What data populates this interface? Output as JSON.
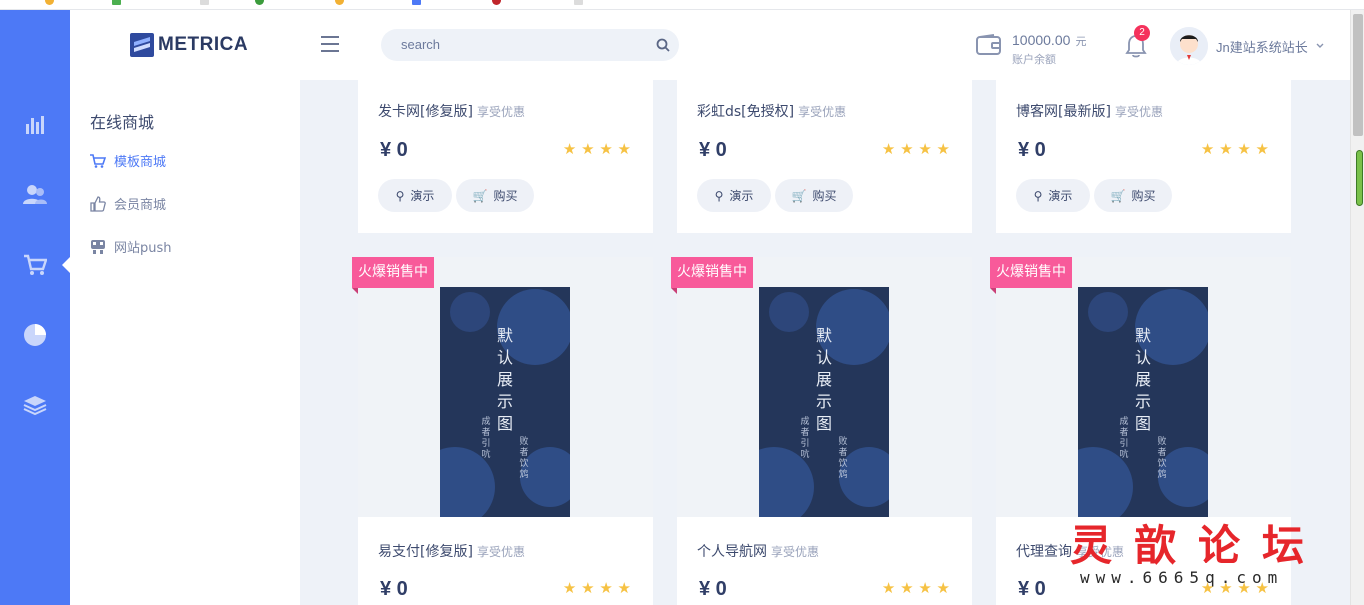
{
  "brand": {
    "name": "METRICA"
  },
  "search": {
    "placeholder": "search"
  },
  "wallet": {
    "amount": "10000.00",
    "unit": "元",
    "label": "账户余额"
  },
  "notifications": {
    "count": "2"
  },
  "user": {
    "name": "Jn建站系统站长"
  },
  "sidebar_icons": [
    "chart-icon",
    "users-icon",
    "cart-icon",
    "pie-icon",
    "layers-icon"
  ],
  "submenu": {
    "title": "在线商城",
    "items": [
      {
        "label": "模板商城",
        "icon": "cart-icon",
        "active": true
      },
      {
        "label": "会员商城",
        "icon": "thumbs-up-icon",
        "active": false
      },
      {
        "label": "网站push",
        "icon": "push-icon",
        "active": false
      }
    ]
  },
  "shop": {
    "demo_label": "演示",
    "buy_label": "购买",
    "promo_label": "享受优惠",
    "hot_label": "火爆销售中",
    "rating": 4,
    "cover": {
      "title": "默认展示图",
      "side_left": "成者引吭",
      "side_right": "败者饮鸩"
    },
    "row1": [
      {
        "name": "发卡网[修复版]",
        "price": "¥ 0"
      },
      {
        "name": "彩虹ds[免授权]",
        "price": "¥ 0"
      },
      {
        "name": "博客网[最新版]",
        "price": "¥ 0"
      }
    ],
    "row2": [
      {
        "name": "易支付[修复版]",
        "price": "¥ 0"
      },
      {
        "name": "个人导航网",
        "price": "¥ 0"
      },
      {
        "name": "代理查询",
        "price": "¥ 0"
      }
    ]
  },
  "watermark": {
    "text": "灵歆论坛",
    "url": "www.6665q.com"
  },
  "colors": {
    "primary": "#4d79f6",
    "hot": "#f85a9a",
    "star": "#f6c244",
    "cover": "#24365a"
  }
}
